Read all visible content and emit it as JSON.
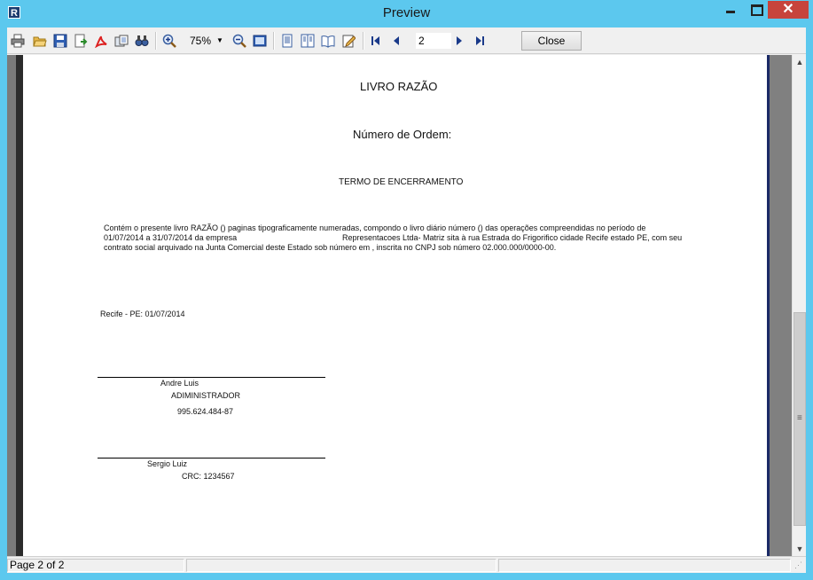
{
  "window": {
    "title": "Preview",
    "app_icon_text": "R",
    "close_glyph": "✕"
  },
  "toolbar": {
    "icons": [
      "print-icon",
      "open-icon",
      "save-icon",
      "export-icon",
      "pdf-icon",
      "email-icon",
      "find-icon",
      "zoom-in-icon",
      "zoom-out-icon",
      "fit-page-icon",
      "one-page-icon",
      "two-pages-icon",
      "book-icon",
      "edit-icon"
    ],
    "zoom_value": "75%",
    "page_value": "2",
    "close_label": "Close"
  },
  "document": {
    "title": "LIVRO RAZÃO",
    "order_label": "Número de Ordem:",
    "section_title": "TERMO DE ENCERRAMENTO",
    "body_line_1": "Contém o presente livro RAZÃO  () paginas tipograficamente numeradas, compondo o livro diário número () das operações compreendidas no período de",
    "body_line_2a": "01/07/2014  a 31/07/2014 da empresa",
    "body_line_2b": "Representacoes Ltda- Matriz sita à rua Estrada do Frigorifico cidade Recife estado PE, com seu",
    "body_line_3": "contrato social arquivado na Junta Comercial deste Estado sob número  em , inscrita no CNPJ sob número 02.000.000/0000-00.",
    "place_date": "Recife - PE: 01/07/2014",
    "signer1_name": "Andre Luis",
    "signer1_role": "ADIMINISTRADOR",
    "signer1_doc": "995.624.484-87",
    "signer2_name": "Sergio Luiz",
    "signer2_doc": "CRC: 1234567"
  },
  "status": {
    "page_info": "Page 2 of 2"
  }
}
